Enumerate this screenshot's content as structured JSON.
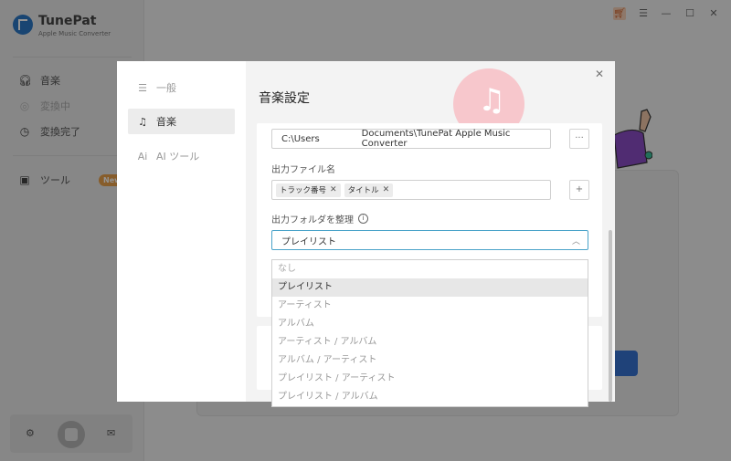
{
  "app": {
    "name": "TunePat",
    "subtitle": "Apple Music Converter",
    "nav": [
      {
        "label": "音楽"
      },
      {
        "label": "変換中"
      },
      {
        "label": "変換完了"
      },
      {
        "label": "ツール",
        "badge": "New"
      }
    ]
  },
  "dialog": {
    "nav": [
      {
        "label": "一般"
      },
      {
        "label": "音楽"
      },
      {
        "label": "AI ツール"
      }
    ],
    "title": "音楽設定",
    "output_path": {
      "prefix": "C:\\Users",
      "suffix": "Documents\\TunePat Apple Music Converter"
    },
    "browse_button": "···",
    "filename_label": "出力ファイル名",
    "filename_tags": [
      "トラック番号",
      "タイトル"
    ],
    "add_tag_button": "+",
    "organize_label": "出力フォルダを整理",
    "organize_selected": "プレイリスト",
    "organize_options": [
      "なし",
      "プレイリスト",
      "アーティスト",
      "アルバム",
      "アーティスト / アルバム",
      "アルバム / アーティスト",
      "プレイリスト / アーティスト",
      "プレイリスト / アルバム"
    ]
  },
  "colors": {
    "accent": "#4aa3c9",
    "brand_blue": "#2b78c5",
    "badge_orange": "#e9a04a",
    "deco_pink": "#f7c7cc"
  }
}
